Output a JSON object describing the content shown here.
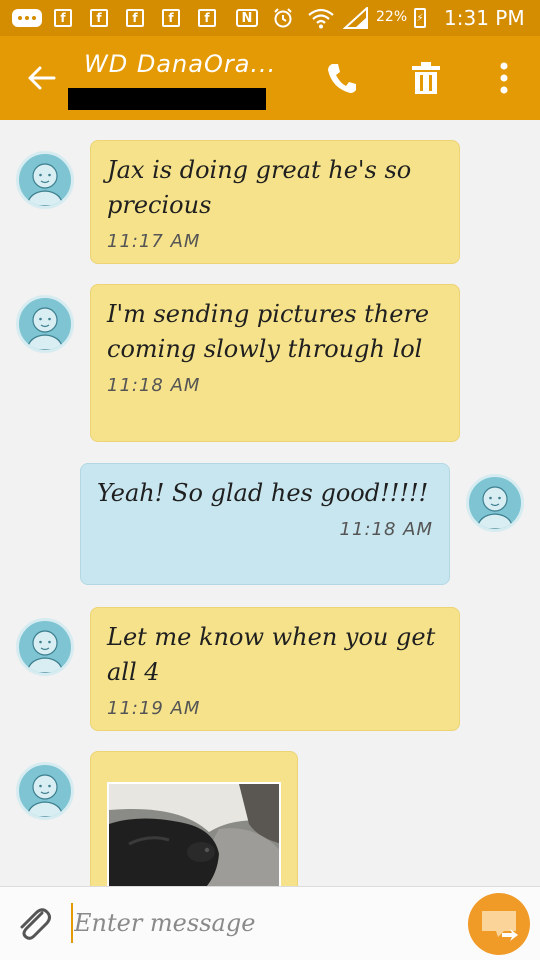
{
  "status_bar": {
    "battery_percent": "22%",
    "time": "1:31 PM",
    "icons": [
      "chat-icon",
      "facebook-icon",
      "facebook-icon",
      "facebook-icon",
      "facebook-icon",
      "facebook-icon",
      "nfc-icon",
      "alarm-icon",
      "wifi-icon",
      "signal-icon",
      "battery-charging-icon"
    ]
  },
  "app_bar": {
    "contact_name": "WD DanaOra...",
    "icons": [
      "back-arrow-icon",
      "phone-icon",
      "trash-icon",
      "more-vert-icon"
    ]
  },
  "messages": [
    {
      "direction": "in",
      "text": "Jax is doing great he's so precious",
      "time": "11:17 AM"
    },
    {
      "direction": "in",
      "text": "I'm sending pictures there coming slowly through lol",
      "time": "11:18 AM"
    },
    {
      "direction": "out",
      "text": "Yeah! So glad hes good!!!!!",
      "time": "11:18 AM"
    },
    {
      "direction": "in",
      "text": "Let me know when you get all 4",
      "time": "11:19 AM"
    },
    {
      "direction": "in",
      "attachment": "photo"
    }
  ],
  "composer": {
    "placeholder": "Enter message",
    "icons": [
      "paperclip-icon",
      "send-icon"
    ]
  },
  "colors": {
    "status_bar": "#d48c00",
    "app_bar": "#e49a05",
    "incoming_bubble": "#f5e28b",
    "outgoing_bubble": "#c8e6ef",
    "avatar": "#7ec4d3",
    "send_button": "#f09a28"
  }
}
